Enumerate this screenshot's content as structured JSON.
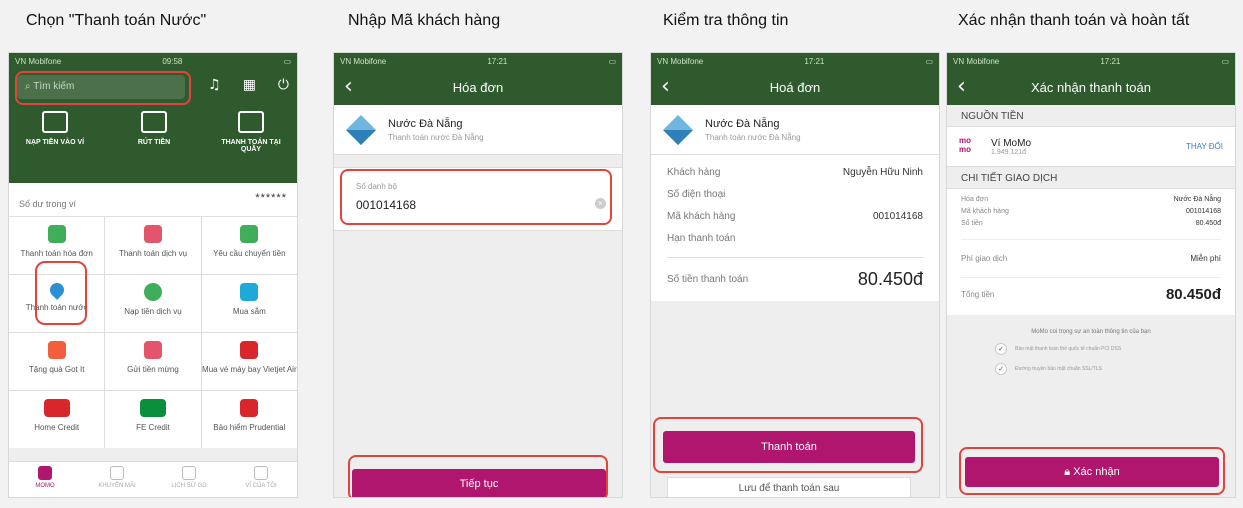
{
  "steps": [
    {
      "title": "Chọn \"Thanh toán Nước\""
    },
    {
      "title": "Nhập Mã khách hàng"
    },
    {
      "title": "Kiểm tra thông tin"
    },
    {
      "title": "Xác nhận thanh toán và hoàn tất"
    }
  ],
  "accent_color": "#b0166e",
  "header_color": "#2f5a2d",
  "highlight_color": "#e0443d",
  "screen1": {
    "status": {
      "carrier": "VN Mobifone",
      "time": "09:58"
    },
    "search_placeholder": "Tìm kiếm",
    "quick": [
      "NẠP TIỀN VÀO VÍ",
      "RÚT TIỀN",
      "THANH TOÁN TẠI QUẦY"
    ],
    "balance_label": "Số dư trong ví",
    "balance_value": "******",
    "services": [
      "Thanh toán hóa đơn",
      "Thanh toán dịch vụ",
      "Yêu cầu chuyển tiền",
      "Thanh toán nước",
      "Nạp tiền dịch vụ",
      "Mua sắm",
      "Tặng quà Got It",
      "Gửi tiền mừng",
      "Mua vé máy bay Vietjet Air",
      "Home Credit",
      "FE Credit",
      "Bảo hiểm Prudential"
    ],
    "tabs": [
      "MOMO",
      "KHUYẾN MÃI",
      "LỊCH SỬ GD",
      "VÍ CỦA TÔI"
    ]
  },
  "screen2": {
    "status": {
      "carrier": "VN Mobifone",
      "time": "17:21"
    },
    "title": "Hóa đơn",
    "provider_name": "Nước Đà Nẵng",
    "provider_sub": "Thanh toán nước Đà Nẵng",
    "field_label": "Số danh bộ",
    "field_value": "001014168",
    "button": "Tiếp tục"
  },
  "screen3": {
    "status": {
      "carrier": "VN Mobifone",
      "time": "17:21"
    },
    "title": "Hoá đơn",
    "provider_name": "Nước Đà Nẵng",
    "provider_sub": "Thanh toán nước Đà Nẵng",
    "rows": [
      {
        "label": "Khách hàng",
        "value": "Nguyễn Hữu Ninh"
      },
      {
        "label": "Số điện thoại",
        "value": ""
      },
      {
        "label": "Mã khách hàng",
        "value": "001014168"
      },
      {
        "label": "Hạn thanh toán",
        "value": ""
      }
    ],
    "total_label": "Số tiền thanh toán",
    "total_value": "80.450đ",
    "pay_button": "Thanh toán",
    "later_button": "Lưu để thanh toán sau"
  },
  "screen4": {
    "status": {
      "carrier": "VN Mobifone",
      "time": "17:21"
    },
    "title": "Xác nhận thanh toán",
    "source_header": "NGUỒN TIỀN",
    "wallet_name": "Ví MoMo",
    "wallet_balance": "1.949.121đ",
    "change": "THAY ĐỔI",
    "detail_header": "CHI TIẾT GIAO DỊCH",
    "details": [
      {
        "label": "Hóa đơn",
        "value": "Nước Đà Nẵng"
      },
      {
        "label": "Mã khách hàng",
        "value": "001014168"
      },
      {
        "label": "Số tiền",
        "value": "80.450đ"
      }
    ],
    "fee_label": "Phí giao dịch",
    "fee_value": "Miễn phí",
    "grand_label": "Tổng tiền",
    "grand_value": "80.450đ",
    "safety": "MoMo coi trọng sự an toàn thông tin của bạn",
    "checks": [
      "Bảo mật thanh toán thẻ quốc tế chuẩn PCI DSS",
      "Đường truyền bảo mật chuẩn SSL/TLS"
    ],
    "confirm_button": "Xác nhận"
  }
}
